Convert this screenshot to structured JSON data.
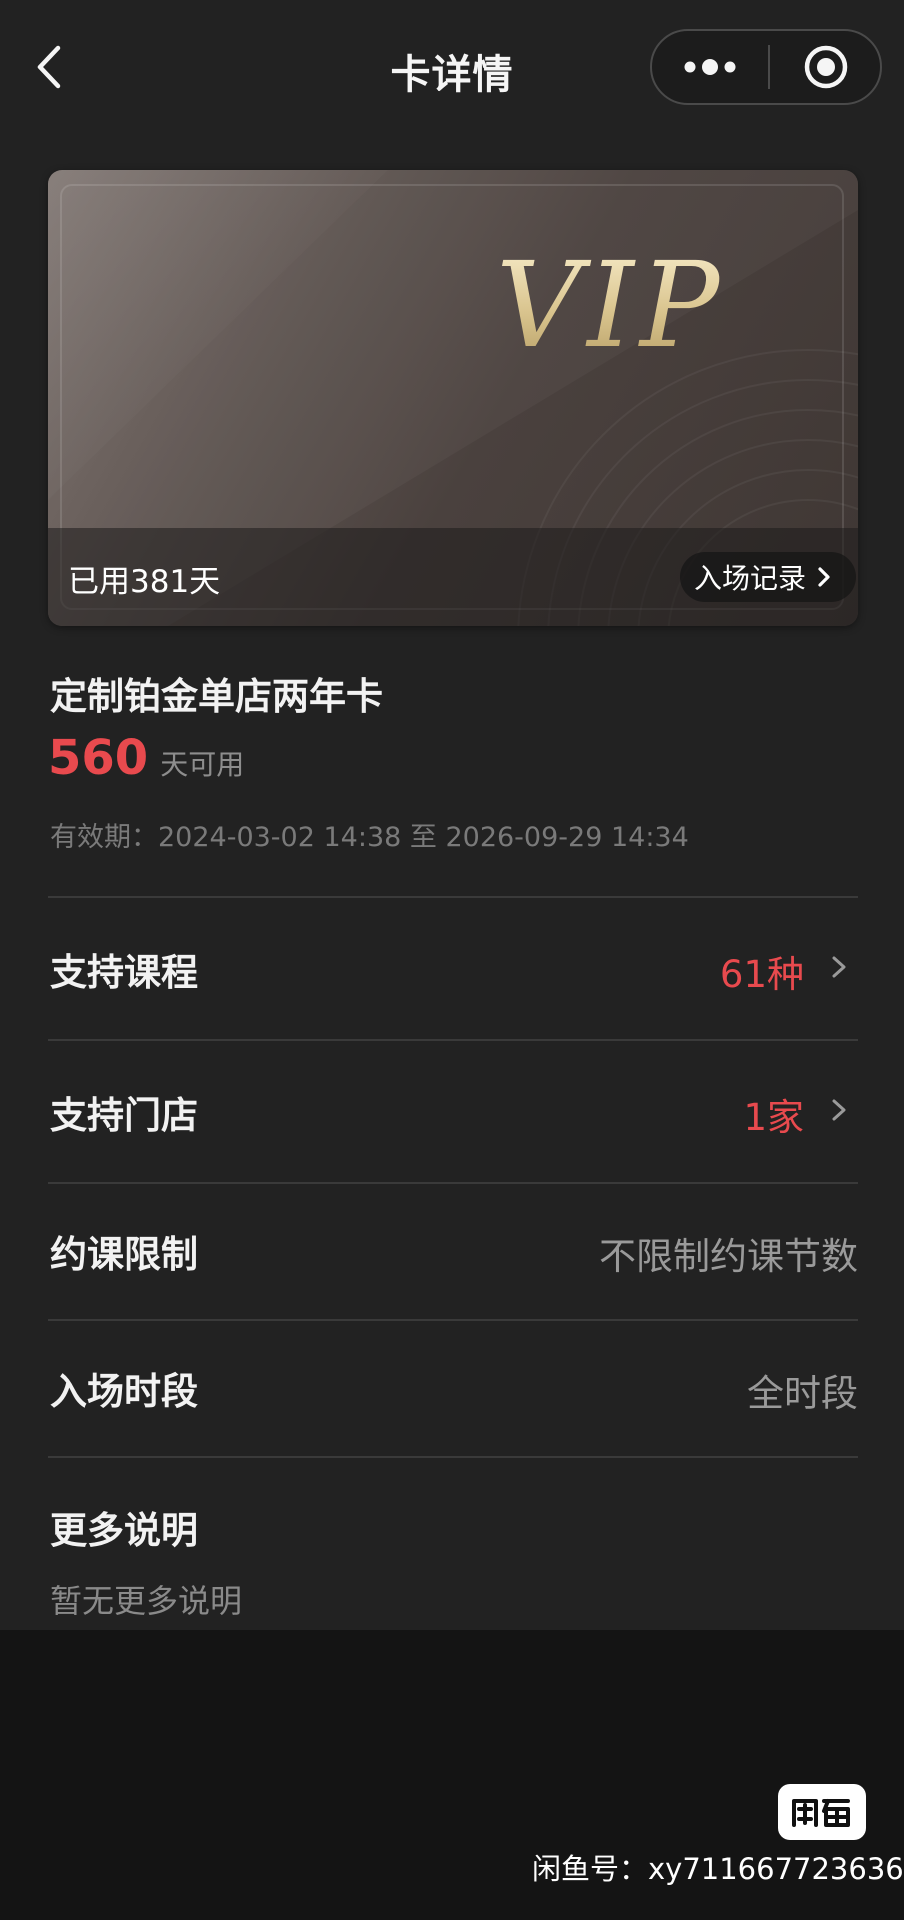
{
  "nav": {
    "title": "卡详情"
  },
  "card": {
    "logo_text": "VIP",
    "used_days": "已用381天",
    "entry_record": "入场记录",
    "name": "定制铂金单店两年卡",
    "remaining_days": "560",
    "remaining_unit": "天可用",
    "validity": "有效期：2024-03-02 14:38 至 2026-09-29 14:34"
  },
  "rows": [
    {
      "label": "支持课程",
      "value": "61种"
    },
    {
      "label": "支持门店",
      "value": "1家"
    },
    {
      "label": "约课限制",
      "value": "不限制约课节数"
    },
    {
      "label": "入场时段",
      "value": "全时段"
    }
  ],
  "more": {
    "title": "更多说明",
    "desc": "暂无更多说明"
  },
  "watermark": {
    "logo_text": "闲鱼",
    "text": "闲鱼号：xy711667723636"
  },
  "colors": {
    "background": "#222222",
    "accent_red": "#e84a4e",
    "vip_gold": "#e8d6a8"
  },
  "icons": {
    "back": "chevron-left-icon",
    "more": "more-dots-icon",
    "close": "target-circle-icon",
    "arrow": "chevron-right-icon"
  }
}
